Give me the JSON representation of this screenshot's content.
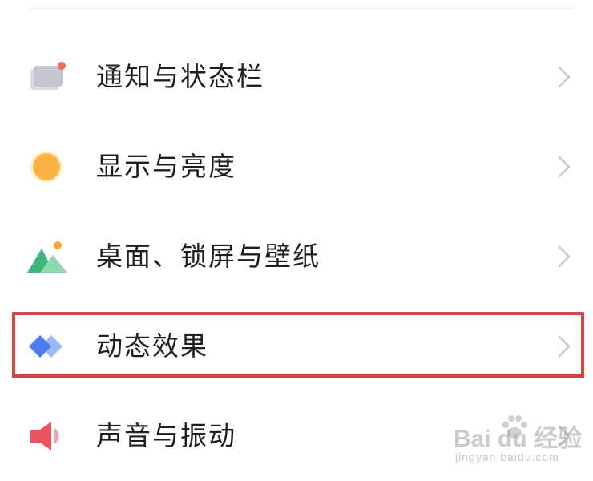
{
  "settings": {
    "items": [
      {
        "label": "通知与状态栏",
        "icon": "notification-statusbar-icon"
      },
      {
        "label": "显示与亮度",
        "icon": "display-brightness-icon"
      },
      {
        "label": "桌面、锁屏与壁纸",
        "icon": "wallpaper-icon"
      },
      {
        "label": "动态效果",
        "icon": "dynamic-effects-icon",
        "highlighted": true
      },
      {
        "label": "声音与振动",
        "icon": "sound-vibration-icon"
      }
    ]
  },
  "highlight_color": "#d9413f",
  "watermark": {
    "main": "Bai  du 经验",
    "sub": "jingyan.baidu.com"
  }
}
